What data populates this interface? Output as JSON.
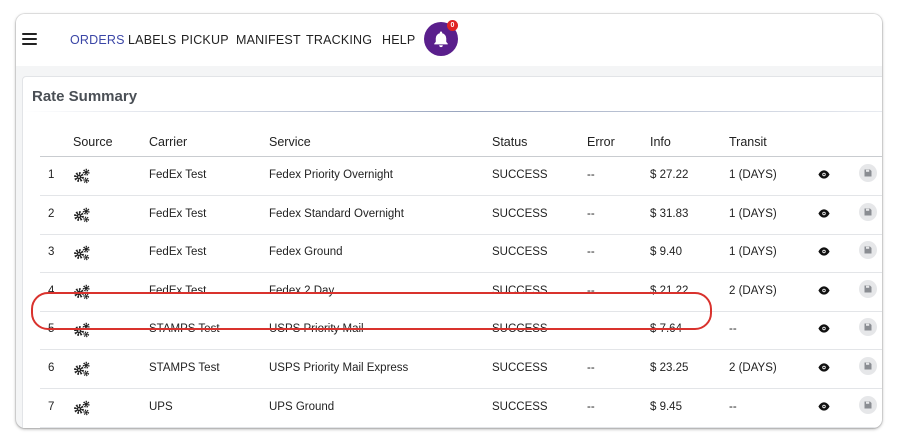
{
  "nav": {
    "items": [
      {
        "label": "ORDERS",
        "active": true
      },
      {
        "label": "LABELS",
        "active": false
      },
      {
        "label": "PICKUP",
        "active": false
      },
      {
        "label": "MANIFEST",
        "active": false
      },
      {
        "label": "TRACKING",
        "active": false
      },
      {
        "label": "HELP",
        "active": false
      }
    ],
    "notification_count": "0"
  },
  "rate_summary": {
    "title": "Rate Summary",
    "columns": [
      "",
      "Source",
      "Carrier",
      "Service",
      "Status",
      "Error",
      "Info",
      "Transit"
    ],
    "rows": [
      {
        "index": "1",
        "source_icon": "gears-icon",
        "carrier": "FedEx Test",
        "service": "Fedex Priority Overnight",
        "status": "SUCCESS",
        "error": "--",
        "info": "$ 27.22",
        "transit": "1 (DAYS)"
      },
      {
        "index": "2",
        "source_icon": "gears-icon",
        "carrier": "FedEx Test",
        "service": "Fedex Standard Overnight",
        "status": "SUCCESS",
        "error": "--",
        "info": "$ 31.83",
        "transit": "1 (DAYS)"
      },
      {
        "index": "3",
        "source_icon": "gears-icon",
        "carrier": "FedEx Test",
        "service": "Fedex Ground",
        "status": "SUCCESS",
        "error": "--",
        "info": "$ 9.40",
        "transit": "1 (DAYS)",
        "highlighted": true
      },
      {
        "index": "4",
        "source_icon": "gears-icon",
        "carrier": "FedEx Test",
        "service": "Fedex 2 Day",
        "status": "SUCCESS",
        "error": "--",
        "info": "$ 21.22",
        "transit": "2 (DAYS)"
      },
      {
        "index": "5",
        "source_icon": "gears-icon",
        "carrier": "STAMPS Test",
        "service": "USPS Priority Mail",
        "status": "SUCCESS",
        "error": "--",
        "info": "$ 7.64",
        "transit": "--"
      },
      {
        "index": "6",
        "source_icon": "gears-icon",
        "carrier": "STAMPS Test",
        "service": "USPS Priority Mail Express",
        "status": "SUCCESS",
        "error": "--",
        "info": "$ 23.25",
        "transit": "2 (DAYS)"
      },
      {
        "index": "7",
        "source_icon": "gears-icon",
        "carrier": "UPS",
        "service": "UPS Ground",
        "status": "SUCCESS",
        "error": "--",
        "info": "$ 9.45",
        "transit": "--"
      }
    ]
  },
  "colors": {
    "nav_active": "#3b46a6",
    "bell_bg": "#5a1f8c",
    "badge": "#e02424",
    "highlight": "#d9322d"
  }
}
